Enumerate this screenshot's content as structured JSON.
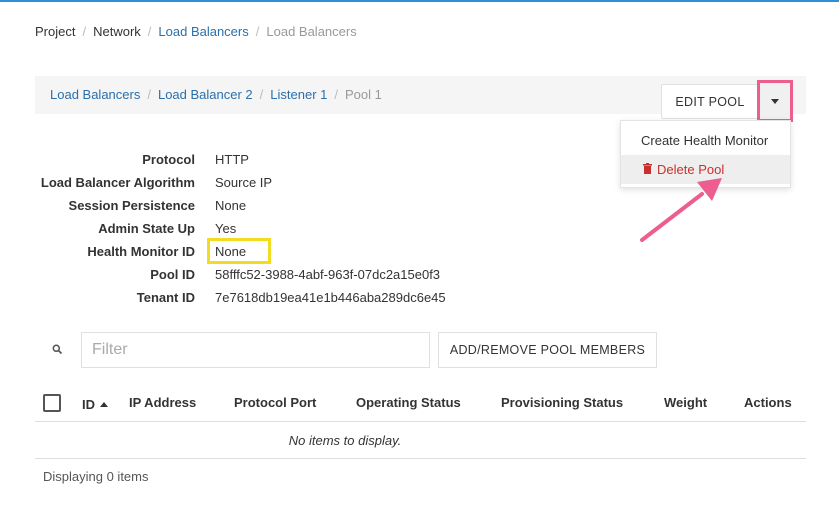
{
  "breadcrumb": {
    "items": [
      {
        "label": "Project",
        "style": "plain"
      },
      {
        "label": "Network",
        "style": "plain"
      },
      {
        "label": "Load Balancers",
        "style": "link"
      },
      {
        "label": "Load Balancers",
        "style": "muted"
      }
    ],
    "separator": "/"
  },
  "detail_breadcrumb": {
    "items": [
      {
        "label": "Load Balancers",
        "style": "link"
      },
      {
        "label": "Load Balancer 2",
        "style": "link"
      },
      {
        "label": "Listener 1",
        "style": "link"
      },
      {
        "label": "Pool 1",
        "style": "muted"
      }
    ]
  },
  "actions": {
    "edit_pool_label": "EDIT POOL",
    "caret_icon": "caret-down-icon",
    "menu": {
      "create_health_monitor": "Create Health Monitor",
      "delete_pool": "Delete Pool",
      "delete_icon": "trash-icon"
    }
  },
  "details": {
    "protocol_label": "Protocol",
    "protocol_value": "HTTP",
    "algorithm_label": "Load Balancer Algorithm",
    "algorithm_value": "Source IP",
    "persistence_label": "Session Persistence",
    "persistence_value": "None",
    "admin_state_label": "Admin State Up",
    "admin_state_value": "Yes",
    "health_monitor_label": "Health Monitor ID",
    "health_monitor_value": "None",
    "pool_id_label": "Pool ID",
    "pool_id_value": "58fffc52-3988-4abf-963f-07dc2a15e0f3",
    "tenant_id_label": "Tenant ID",
    "tenant_id_value": "7e7618db19ea41e1b446aba289dc6e45"
  },
  "filter": {
    "placeholder": "Filter",
    "value": "",
    "icon": "search-icon",
    "add_members_label": "ADD/REMOVE POOL MEMBERS"
  },
  "table": {
    "columns": {
      "id": "ID",
      "ip_address": "IP Address",
      "protocol_port": "Protocol Port",
      "operating_status": "Operating Status",
      "provisioning_status": "Provisioning Status",
      "weight": "Weight",
      "actions": "Actions"
    },
    "empty_message": "No items to display.",
    "footer": "Displaying 0 items"
  },
  "colors": {
    "link": "#2a6fad",
    "danger": "#c9302c",
    "annotation_pink": "#ec5d90",
    "annotation_yellow": "#f1dc1f"
  }
}
